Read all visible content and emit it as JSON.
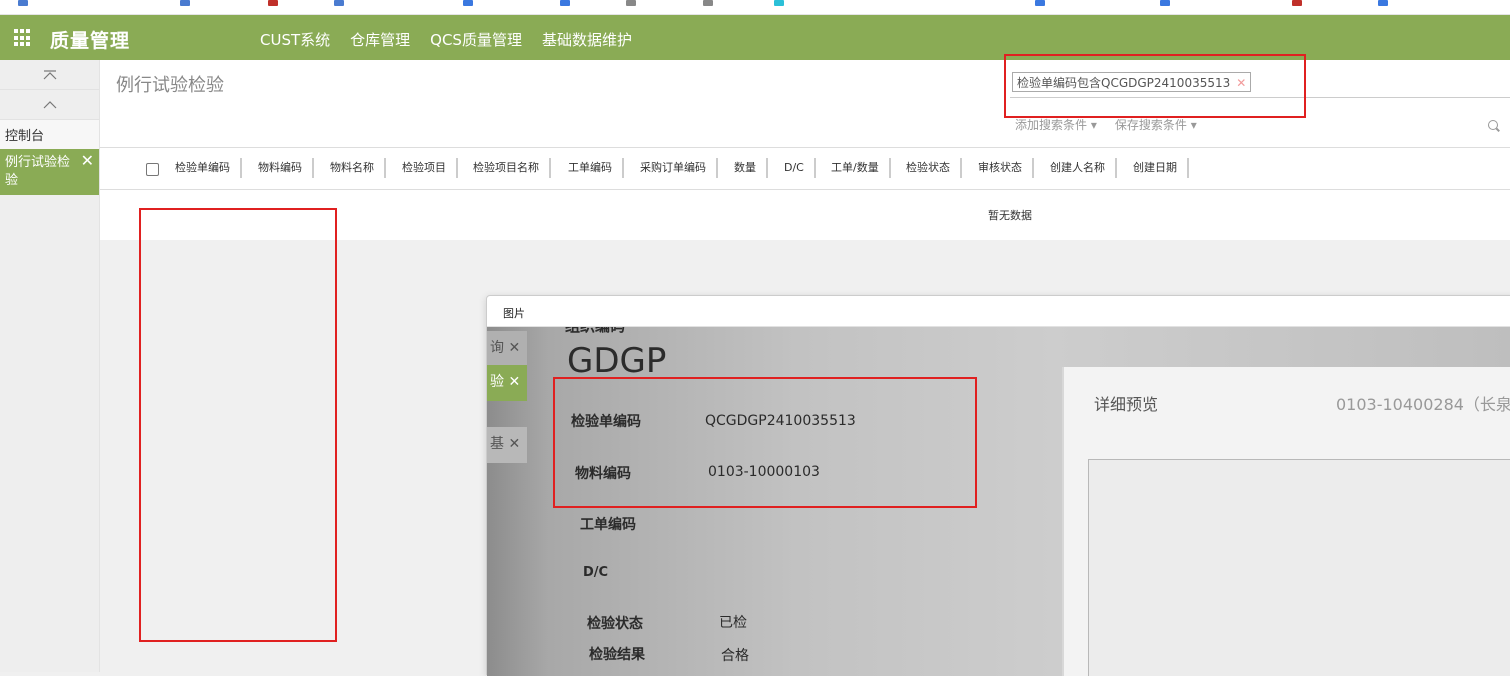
{
  "app": {
    "brand": "质量管理",
    "nav": [
      "CUST系统",
      "仓库管理",
      "QCS质量管理",
      "基础数据维护"
    ]
  },
  "sidebar": {
    "items": [
      {
        "label": "控制台"
      },
      {
        "label": "例行试验检验"
      }
    ],
    "close_label": "✕"
  },
  "page": {
    "title": "例行试验检验",
    "search": {
      "facet": "检验单编码包含QCGDGP2410035513",
      "add_filter": "添加搜索条件",
      "save_filter": "保存搜索条件"
    },
    "table": {
      "columns": [
        "检验单编码",
        "物料编码",
        "物料名称",
        "检验项目",
        "检验项目名称",
        "工单编码",
        "采购订单编码",
        "数量",
        "D/C",
        "工单/数量",
        "检验状态",
        "审核状态",
        "创建人名称",
        "创建日期"
      ],
      "empty": "暂无数据"
    }
  },
  "modal": {
    "title": "图片",
    "photo": {
      "side_tabs": [
        "询",
        "验",
        "基"
      ],
      "heading_partial": "组织编码",
      "org_code": "GDGP",
      "fields": [
        {
          "label": "检验单编码",
          "value": "QCGDGP2410035513"
        },
        {
          "label": "物料编码",
          "value": "0103-10000103"
        },
        {
          "label": "工单编码",
          "value": ""
        },
        {
          "label": "D/C",
          "value": ""
        },
        {
          "label": "检验状态",
          "value": "已检"
        },
        {
          "label": "检验结果",
          "value": "合格"
        }
      ],
      "preview_title": "详细预览",
      "preview_code": "0103-10400284（长泉"
    }
  },
  "colors": {
    "topbar": "#8aab55",
    "highlight": "#e02020"
  }
}
